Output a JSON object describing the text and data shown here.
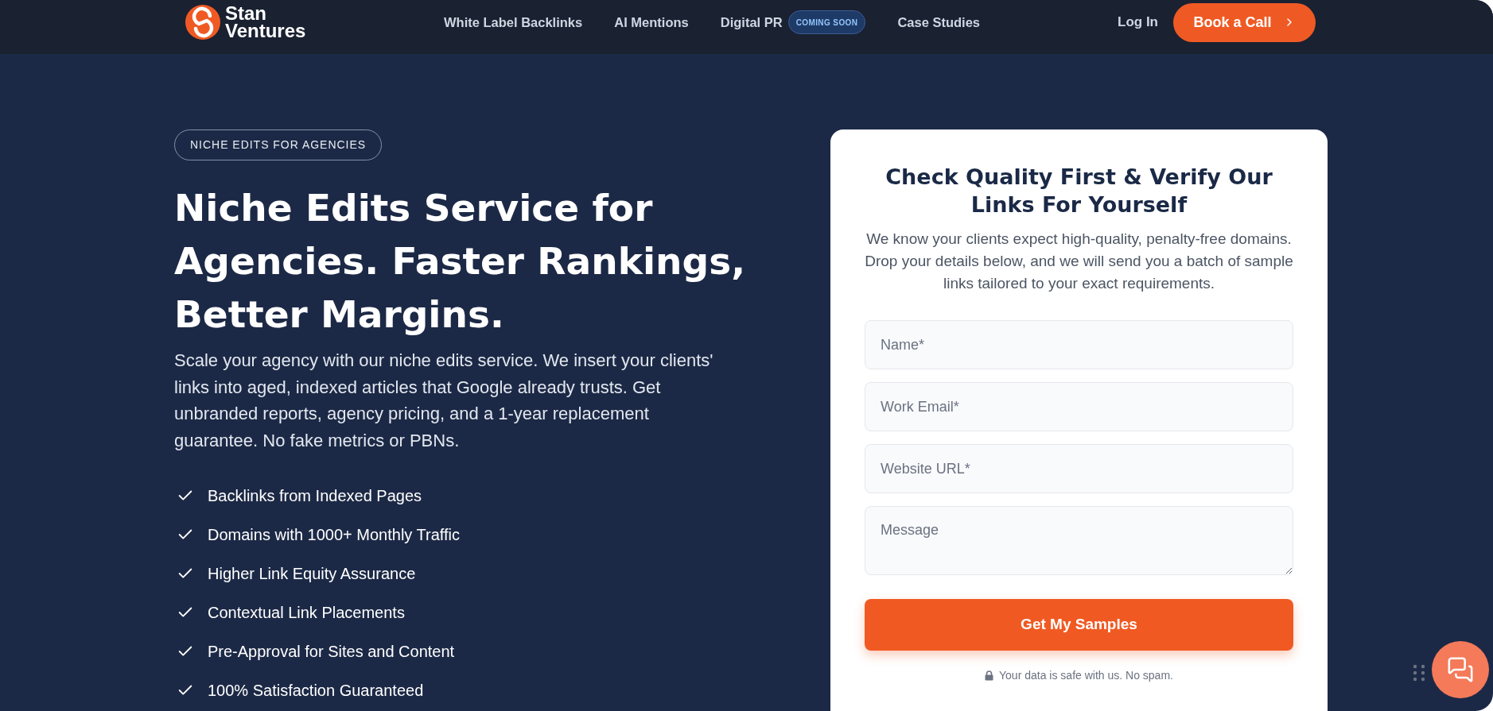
{
  "nav": {
    "logo_text": "Stan Ventures",
    "links": [
      {
        "label": "White Label Backlinks"
      },
      {
        "label": "AI Mentions"
      },
      {
        "label": "Digital PR",
        "badge": "COMING SOON"
      },
      {
        "label": "Case Studies"
      }
    ],
    "login": "Log In",
    "cta": "Book a Call"
  },
  "hero": {
    "tag": "NICHE EDITS FOR AGENCIES",
    "heading": "Niche Edits Service for Agencies. Faster Rankings, Better Margins.",
    "description": "Scale your agency with our niche edits service. We insert your clients' links into aged, indexed articles that Google already trusts. Get unbranded reports, agency pricing, and a 1-year replacement guarantee. No fake metrics or PBNs.",
    "features": [
      "Backlinks from Indexed Pages",
      "Domains with 1000+ Monthly Traffic",
      "Higher Link Equity Assurance",
      "Contextual Link Placements",
      "Pre-Approval for Sites and Content",
      "100% Satisfaction Guaranteed"
    ]
  },
  "form": {
    "title": "Check Quality First & Verify Our Links For Yourself",
    "description": "We know your clients expect high-quality, penalty-free domains. Drop your details below, and we will send you a batch of sample links tailored to your exact requirements.",
    "fields": [
      {
        "kind": "input",
        "placeholder": "Name*"
      },
      {
        "kind": "input",
        "placeholder": "Work Email*"
      },
      {
        "kind": "input",
        "placeholder": "Website URL*"
      },
      {
        "kind": "textarea",
        "placeholder": "Message"
      }
    ],
    "submit": "Get My Samples",
    "note": "Your data is safe with us. No spam."
  }
}
